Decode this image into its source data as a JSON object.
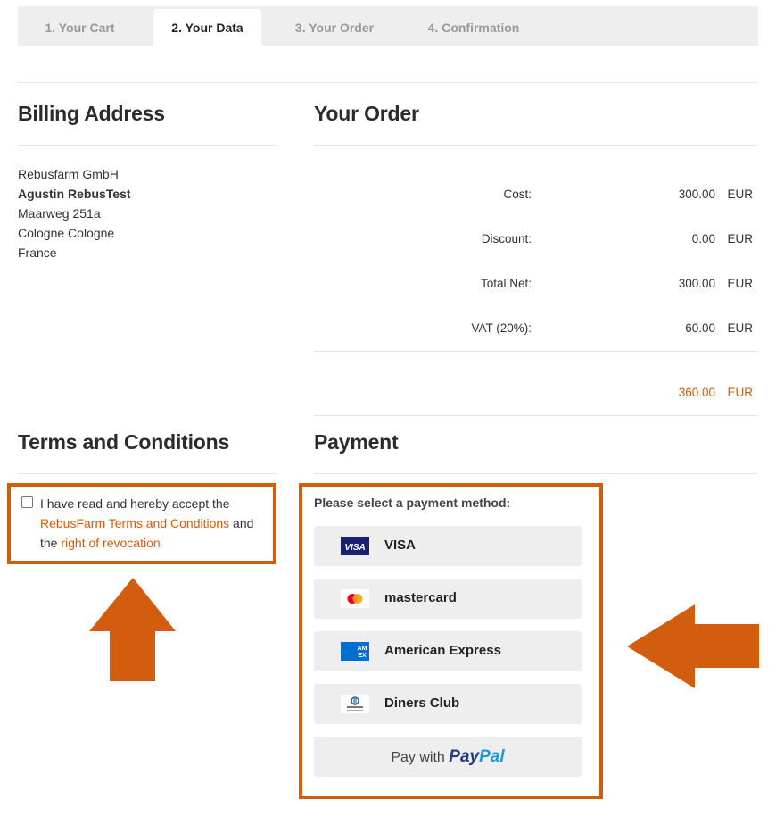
{
  "steps": [
    {
      "label": "1. Your Cart",
      "active": false
    },
    {
      "label": "2. Your Data",
      "active": true
    },
    {
      "label": "3. Your Order",
      "active": false
    },
    {
      "label": "4. Confirmation",
      "active": false
    }
  ],
  "billing": {
    "title": "Billing Address",
    "company": "Rebusfarm GmbH",
    "name": "Agustin RebusTest",
    "street": "Maarweg 251a",
    "city": "Cologne Cologne",
    "country": "France"
  },
  "order": {
    "title": "Your Order",
    "rows": [
      {
        "label": "Cost:",
        "value": "300.00",
        "currency": "EUR"
      },
      {
        "label": "Discount:",
        "value": "0.00",
        "currency": "EUR"
      },
      {
        "label": "Total Net:",
        "value": "300.00",
        "currency": "EUR"
      },
      {
        "label": "VAT (20%):",
        "value": "60.00",
        "currency": "EUR"
      }
    ],
    "total": {
      "value": "360.00",
      "currency": "EUR"
    }
  },
  "terms": {
    "title": "Terms and Conditions",
    "checked": false,
    "text_before": "I have read and hereby accept the ",
    "link_terms": "RebusFarm Terms and Conditions",
    "text_middle": " and the ",
    "link_revocation": "right of revocation"
  },
  "payment": {
    "title": "Payment",
    "prompt": "Please select a payment method:",
    "methods": [
      {
        "name": "VISA",
        "icon": "visa-logo-icon"
      },
      {
        "name": "mastercard",
        "icon": "mastercard-logo-icon"
      },
      {
        "name": "American Express",
        "icon": "amex-logo-icon"
      },
      {
        "name": "Diners Club",
        "icon": "diners-club-logo-icon"
      }
    ],
    "paypal": {
      "prefix": "Pay with ",
      "brand_a": "Pay",
      "brand_b": "Pal"
    }
  },
  "colors": {
    "accent": "#d35d0e",
    "tab_bar": "#eeeeee",
    "paypal_dark": "#253b80",
    "paypal_light": "#179bd7",
    "visa_blue": "#1a1f71",
    "amex_blue": "#016fd0"
  }
}
